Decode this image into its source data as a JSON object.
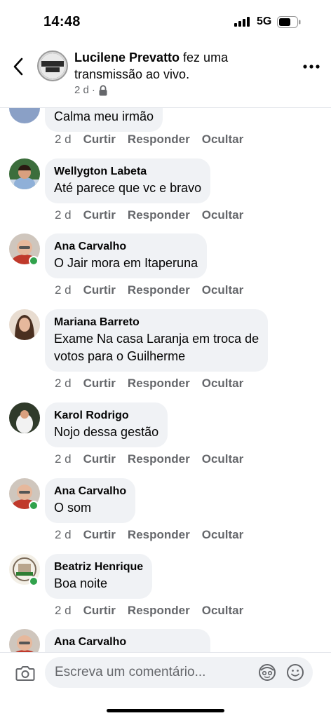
{
  "status_bar": {
    "time": "14:48",
    "network": "5G"
  },
  "header": {
    "author": "Lucilene Prevatto",
    "action_text": " fez uma transmissão ao vivo.",
    "time": "2 d",
    "separator": "·",
    "page_avatar_text": "AJUDAR SE JULGAR",
    "icons": [
      "back-arrow-icon",
      "lock-icon",
      "more-options-icon"
    ]
  },
  "comments": [
    {
      "author": "",
      "text": "Calma meu irmão",
      "time": "2 d",
      "like": "Curtir",
      "reply": "Responder",
      "hide": "Ocultar",
      "online": false
    },
    {
      "author": "Wellygton Labeta",
      "text": "Até parece que vc e bravo",
      "time": "2 d",
      "like": "Curtir",
      "reply": "Responder",
      "hide": "Ocultar",
      "online": false
    },
    {
      "author": "Ana Carvalho",
      "text": "O Jair mora em Itaperuna",
      "time": "2 d",
      "like": "Curtir",
      "reply": "Responder",
      "hide": "Ocultar",
      "online": true
    },
    {
      "author": "Mariana Barreto",
      "text_line1": "Exame   Na casa Laranja  em troca de",
      "text_line2": "votos para o Guilherme",
      "time": "2 d",
      "like": "Curtir",
      "reply": "Responder",
      "hide": "Ocultar",
      "online": false
    },
    {
      "author": "Karol Rodrigo",
      "text": "Nojo dessa gestão",
      "time": "2 d",
      "like": "Curtir",
      "reply": "Responder",
      "hide": "Ocultar",
      "online": false
    },
    {
      "author": "Ana Carvalho",
      "text": "O som",
      "time": "2 d",
      "like": "Curtir",
      "reply": "Responder",
      "hide": "Ocultar",
      "online": true
    },
    {
      "author": "Beatriz Henrique",
      "text": "Boa noite",
      "time": "2 d",
      "like": "Curtir",
      "reply": "Responder",
      "hide": "Ocultar",
      "online": true
    },
    {
      "author": "Ana Carvalho",
      "text": "",
      "online": false
    }
  ],
  "composer": {
    "placeholder": "Escreva um comentário...",
    "icons": [
      "camera-icon",
      "avatar-sticker-icon",
      "emoji-icon"
    ]
  },
  "colors": {
    "bubble": "#f0f2f5",
    "secondary_text": "#65676b",
    "online": "#31a24c"
  }
}
